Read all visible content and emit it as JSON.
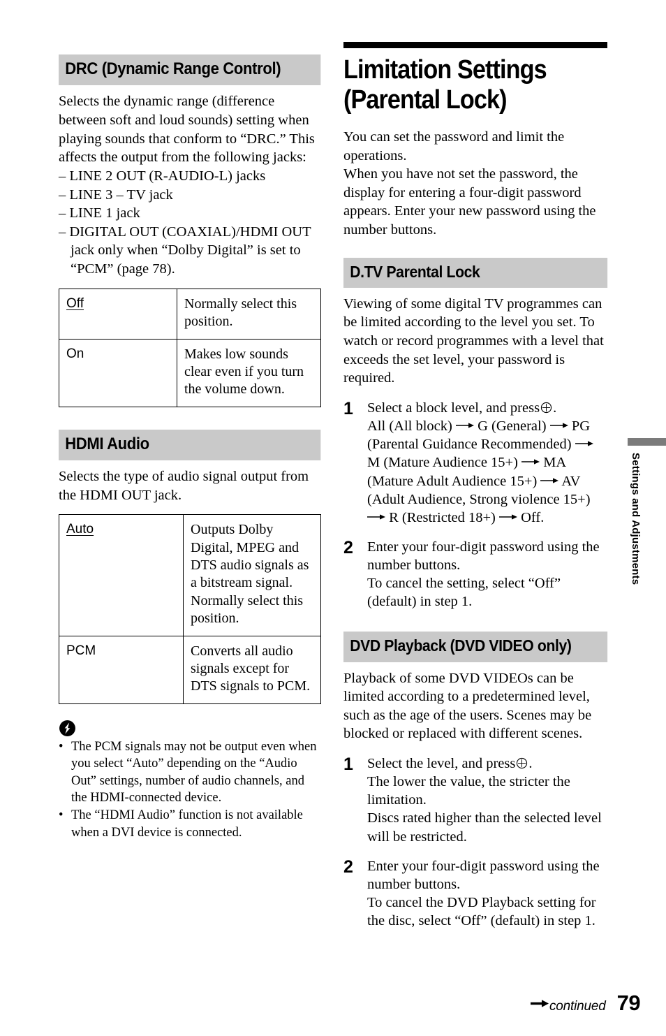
{
  "left_column": {
    "drc": {
      "heading": "DRC (Dynamic Range Control)",
      "intro": "Selects the dynamic range (difference between soft and loud sounds) setting when playing sounds that conform to “DRC.” This affects the output from the following jacks:",
      "jack_list": [
        "– LINE 2 OUT (R-AUDIO-L) jacks",
        "– LINE 3 – TV jack",
        "– LINE 1 jack",
        "– DIGITAL OUT (COAXIAL)/HDMI OUT"
      ],
      "jack_list_last_cont": "jack only when “Dolby Digital” is set to “PCM” (page 78).",
      "table": [
        {
          "option": "Off",
          "underlined": "true",
          "description": "Normally select this position."
        },
        {
          "option": "On",
          "underlined": "false",
          "description": "Makes low sounds clear even if you turn the volume down."
        }
      ]
    },
    "hdmi_audio": {
      "heading": "HDMI Audio",
      "intro": "Selects the type of audio signal output from the HDMI OUT jack.",
      "table": [
        {
          "option": "Auto",
          "underlined": "true",
          "description": "Outputs Dolby Digital, MPEG and DTS audio signals as a bitstream signal. Normally select this position."
        },
        {
          "option": "PCM",
          "underlined": "false",
          "description": "Converts all audio signals except for DTS signals to PCM."
        }
      ],
      "notes": [
        "The PCM signals may not be output even when you select “Auto” depending on the “Audio Out” settings, number of audio channels, and the HDMI-connected device.",
        "The “HDMI Audio” function is not available when a DVI device is connected."
      ]
    }
  },
  "right_column": {
    "chapter_title": "Limitation Settings (Parental Lock)",
    "chapter_intro_1": "You can set the password and limit the operations.",
    "chapter_intro_2": "When you have not set the password, the display for entering a four-digit password appears. Enter your new password using the number buttons.",
    "dtv": {
      "heading": "D.TV Parental Lock",
      "intro": "Viewing of some digital TV programmes can be limited according to the level you set. To watch or record programmes with a level that exceeds the set level, your password is required.",
      "step1_num": "1",
      "step1_line1_a": "Select a block level, and press",
      "step1_line1_b": ".",
      "step1_chain": [
        "All (All block)",
        "G (General)",
        "PG (Parental Guidance Recommended)",
        "M (Mature Audience 15+)",
        "MA (Mature Adult Audience 15+)",
        "AV (Adult Audience, Strong violence 15+)",
        "R (Restricted 18+)",
        "Off."
      ],
      "step2_num": "2",
      "step2_line1": "Enter your four-digit password using the number buttons.",
      "step2_line2": "To cancel the setting, select “Off” (default) in step 1."
    },
    "dvd_playback": {
      "heading": "DVD Playback (DVD VIDEO only)",
      "intro": "Playback of some DVD VIDEOs can be limited according to a predetermined level, such as the age of the users. Scenes may be blocked or replaced with different scenes.",
      "step1_num": "1",
      "step1_line1_a": "Select the level, and press",
      "step1_line1_b": ".",
      "step1_line2": "The lower the value, the stricter the limitation.",
      "step1_line3": "Discs rated higher than the selected level will be restricted.",
      "step2_num": "2",
      "step2_line1": "Enter your four-digit password using the number buttons.",
      "step2_line2": "To cancel the DVD Playback setting for the disc, select “Off” (default) in step 1."
    }
  },
  "side_tab": {
    "label": "Settings and Adjustments"
  },
  "footer": {
    "continued_label": "continued",
    "page_number": "79"
  },
  "colors": {
    "heading_band": "#c9c9c9",
    "side_tab_bar": "#7b7b7b",
    "rule": "#000000"
  },
  "icons": {
    "note": "note-lightning-icon",
    "enter": "enter-circle-cross-icon",
    "arrow": "right-arrow-icon",
    "continued_arrow": "continued-arrow-icon"
  }
}
